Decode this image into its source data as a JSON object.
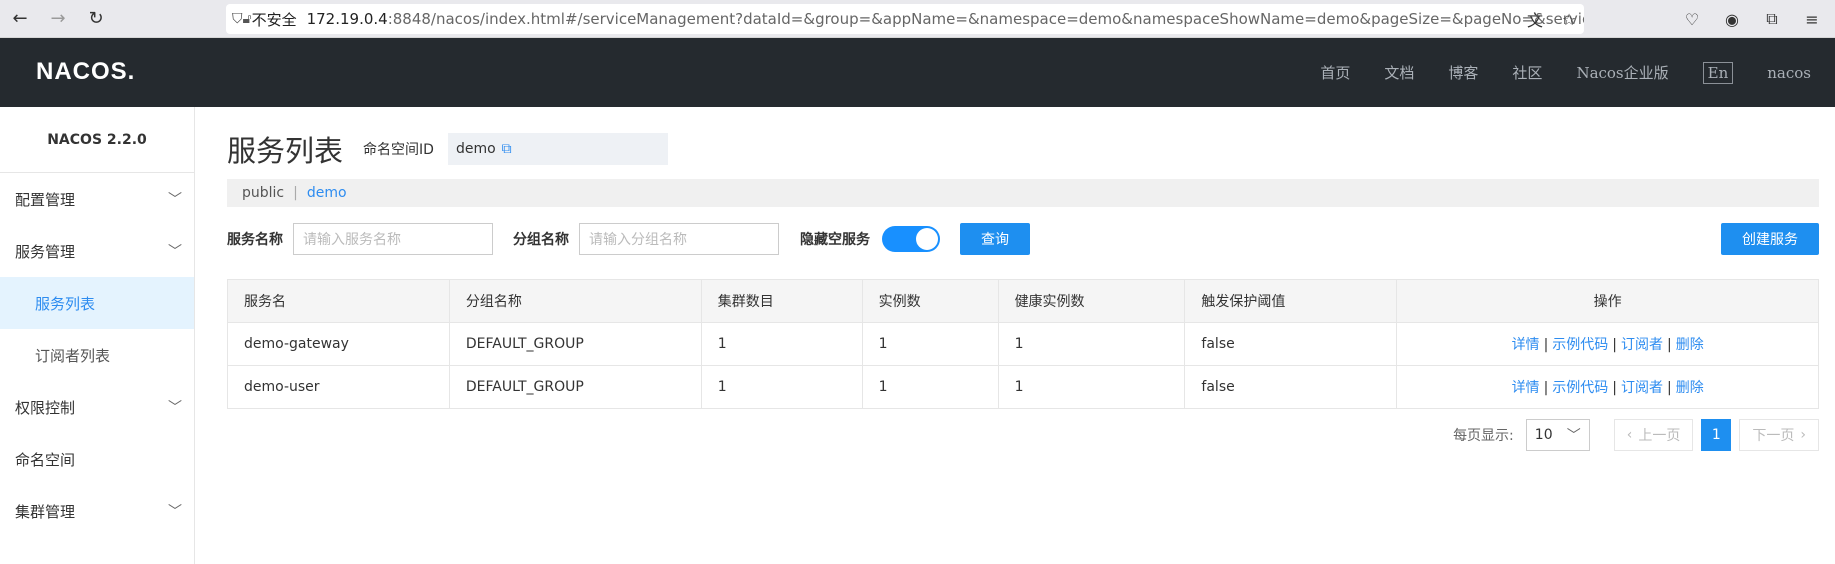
{
  "browser": {
    "insecure_label": "不安全",
    "url_host": "172.19.0.4",
    "url_rest": ":8848/nacos/index.html#/serviceManagement?dataId=&group=&appName=&namespace=demo&namespaceShowName=demo&pageSize=&pageNo=&service"
  },
  "header": {
    "logo": "NACOS.",
    "links": [
      "首页",
      "文档",
      "博客",
      "社区",
      "Nacos企业版"
    ],
    "lang": "En",
    "user": "nacos"
  },
  "sidebar": {
    "version": "NACOS 2.2.0",
    "items": [
      {
        "label": "配置管理"
      },
      {
        "label": "服务管理"
      },
      {
        "label": "服务列表"
      },
      {
        "label": "订阅者列表"
      },
      {
        "label": "权限控制"
      },
      {
        "label": "命名空间"
      },
      {
        "label": "集群管理"
      }
    ]
  },
  "main": {
    "title": "服务列表",
    "namespace_label": "命名空间ID",
    "namespace_value": "demo",
    "ns_public": "public",
    "ns_current": "demo",
    "filters": {
      "service_name_label": "服务名称",
      "service_name_placeholder": "请输入服务名称",
      "group_label": "分组名称",
      "group_placeholder": "请输入分组名称",
      "hide_empty_label": "隐藏空服务",
      "query_button": "查询",
      "create_button": "创建服务"
    },
    "table": {
      "headers": [
        "服务名",
        "分组名称",
        "集群数目",
        "实例数",
        "健康实例数",
        "触发保护阈值",
        "操作"
      ],
      "rows": [
        {
          "name": "demo-gateway",
          "group": "DEFAULT_GROUP",
          "clusters": "1",
          "instances": "1",
          "healthy": "1",
          "threshold": "false"
        },
        {
          "name": "demo-user",
          "group": "DEFAULT_GROUP",
          "clusters": "1",
          "instances": "1",
          "healthy": "1",
          "threshold": "false"
        }
      ],
      "ops": {
        "detail": "详情",
        "sample": "示例代码",
        "subscribers": "订阅者",
        "delete": "删除"
      }
    },
    "pager": {
      "page_size_label": "每页显示:",
      "page_size": "10",
      "prev": "上一页",
      "current": "1",
      "next": "下一页"
    }
  }
}
